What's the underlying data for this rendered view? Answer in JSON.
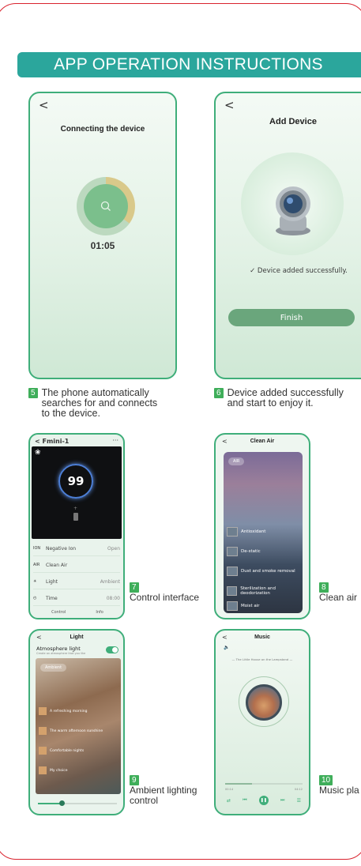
{
  "header": {
    "title": "APP OPERATION INSTRUCTIONS"
  },
  "screen1": {
    "back": "<",
    "title": "Connecting the device",
    "timer": "01:05"
  },
  "screen2": {
    "back": "<",
    "title": "Add Device",
    "status": "✓ Device added successfully.",
    "button": "Finish"
  },
  "step5": {
    "num": "5",
    "text": "The phone automatically\nsearches for and connects\nto the device."
  },
  "step6": {
    "num": "6",
    "text": "Device added successfully\nand start to enjoy it."
  },
  "control": {
    "back": "<",
    "title": "Fmini-1",
    "more": "···",
    "value": "99",
    "rows": [
      {
        "icon": "ION",
        "label": "Negative Ion",
        "value": "Open"
      },
      {
        "icon": "AIR",
        "label": "Clean Air",
        "value": ""
      },
      {
        "icon": "☀",
        "label": "Light",
        "value": "Ambient"
      },
      {
        "icon": "◴",
        "label": "Time",
        "value": "08:00"
      }
    ],
    "tabs": [
      "Control",
      "Info"
    ]
  },
  "step7": {
    "num": "7",
    "text": "Control interface"
  },
  "cleanair": {
    "back": "<",
    "title": "Clean Air",
    "pill": "AIR",
    "items": [
      "Antioxidant",
      "De-static",
      "Dust and smoke removal",
      "Sterilization and deodorization",
      "Moist air"
    ]
  },
  "step8": {
    "num": "8",
    "text": "Clean air"
  },
  "light": {
    "back": "<",
    "title": "Light",
    "toggle_label": "Atmosphere light",
    "toggle_sub": "Create an atmosphere that you like",
    "pill": "Ambient",
    "items": [
      "A refreshing morning",
      "The warm afternoon sunshine",
      "Comfortable nights",
      "My choice"
    ],
    "brightness": 0.3
  },
  "step9": {
    "num": "9",
    "text": "Ambient lighting\ncontrol"
  },
  "music": {
    "back": "<",
    "title": "Music",
    "song": "— The Little House on the Lampstand —",
    "elapsed": "00:14",
    "total": "04:12",
    "progress": 0.35
  },
  "step10": {
    "num": "10",
    "text": "Music pla"
  }
}
